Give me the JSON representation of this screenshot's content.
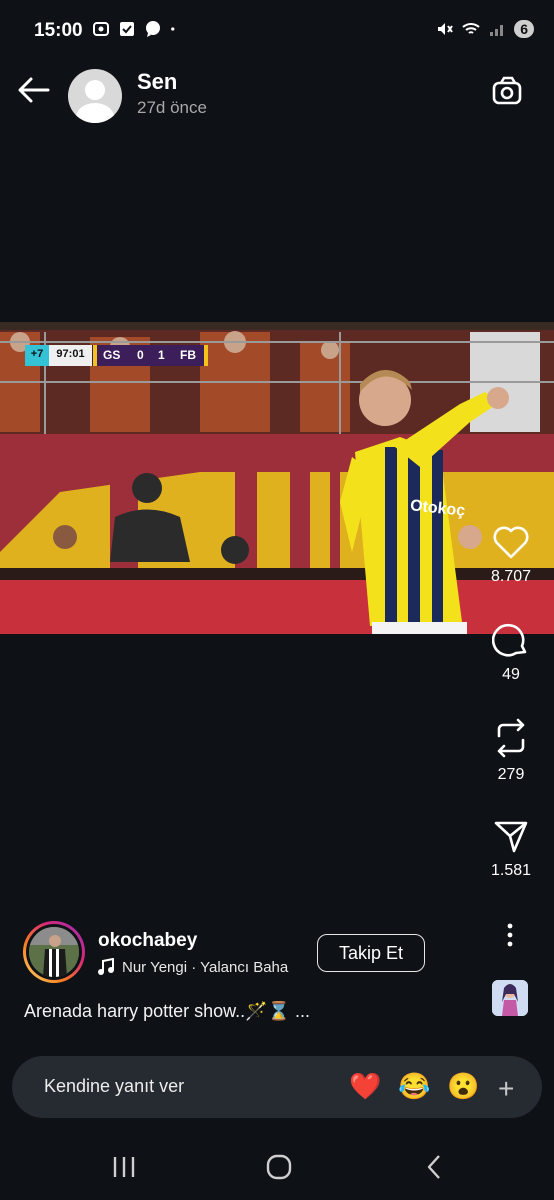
{
  "status": {
    "time": "15:00",
    "battery": "6"
  },
  "header": {
    "username": "Sen",
    "time_ago": "27d önce"
  },
  "video": {
    "scoreboard": {
      "extra": "+7",
      "clock": "97:01",
      "home": "GS",
      "home_score": "0",
      "away_score": "1",
      "away": "FB"
    },
    "sponsor_text": "Otokoç"
  },
  "actions": {
    "likes": "8.707",
    "comments": "49",
    "reposts": "279",
    "shares": "1.581"
  },
  "author": {
    "name": "okochabey",
    "music": "Nur Yengi · Yalancı Baha",
    "follow_label": "Takip Et"
  },
  "caption": "Arenada harry potter show..🪄⌛ ...",
  "reply": {
    "placeholder": "Kendine yanıt ver",
    "emojis": [
      "❤️",
      "😂",
      "😮"
    ],
    "plus": "+"
  },
  "icons": [
    "back-arrow-icon",
    "camera-icon",
    "heart-icon",
    "comment-icon",
    "repost-icon",
    "share-icon",
    "more-icon",
    "music-icon"
  ]
}
